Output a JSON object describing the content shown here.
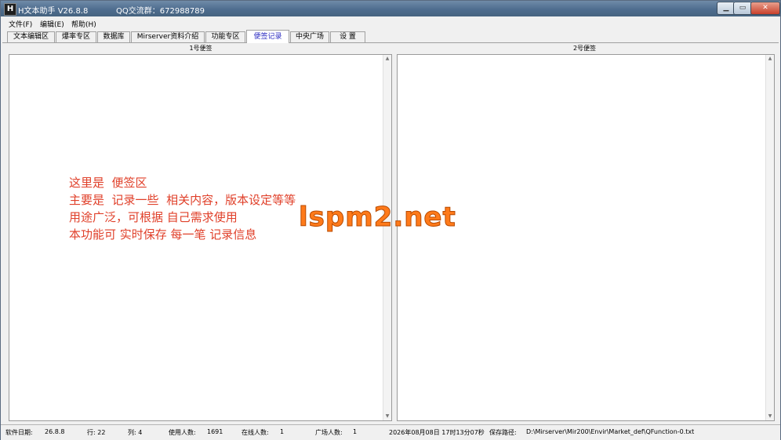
{
  "titlebar": {
    "app_icon": "H",
    "title": "H文本助手  V26.8.8",
    "qq_group": "QQ交流群：672988789",
    "min_icon": "▁",
    "max_icon": "▭",
    "close_icon": "✕"
  },
  "menu": {
    "items": [
      "文件(F)",
      "编辑(E)",
      "帮助(H)"
    ]
  },
  "tabs": {
    "items": [
      "文本编辑区",
      "爆率专区",
      "数据库",
      "Mirserver资料介绍",
      "功能专区",
      "便签记录",
      "中央广场",
      "设  置"
    ],
    "active_index": 5
  },
  "panes": {
    "left_label": "1号便签",
    "right_label": "2号便签"
  },
  "note": {
    "text": "这里是  便签区\n主要是  记录一些  相关内容，版本设定等等\n用途广泛，可根据 自己需求使用\n本功能可 实时保存 每一笔 记录信息"
  },
  "watermark": "lspm2.net",
  "scroll": {
    "up_icon": "▲",
    "down_icon": "▼"
  },
  "status": {
    "software_date": "软件日期:",
    "software_date_value": "26.8.8",
    "row": "行: 22",
    "col": "列: 4",
    "users": "使用人数:",
    "users_value": "1691",
    "online": "在线人数:",
    "online_value": "1",
    "plaza": "广场人数:",
    "plaza_value": "1",
    "datetime": "2026年08月08日 17时13分07秒",
    "save_path_label": "保存路径:",
    "save_path": "D:\\Mirserver\\Mir200\\Envir\\Market_def\\QFunction-0.txt"
  },
  "colors": {
    "note": "#e0402a",
    "watermark": "#ff7a1a",
    "active_tab": "#2b2bc0",
    "titlebar": "#4e6d8f"
  }
}
